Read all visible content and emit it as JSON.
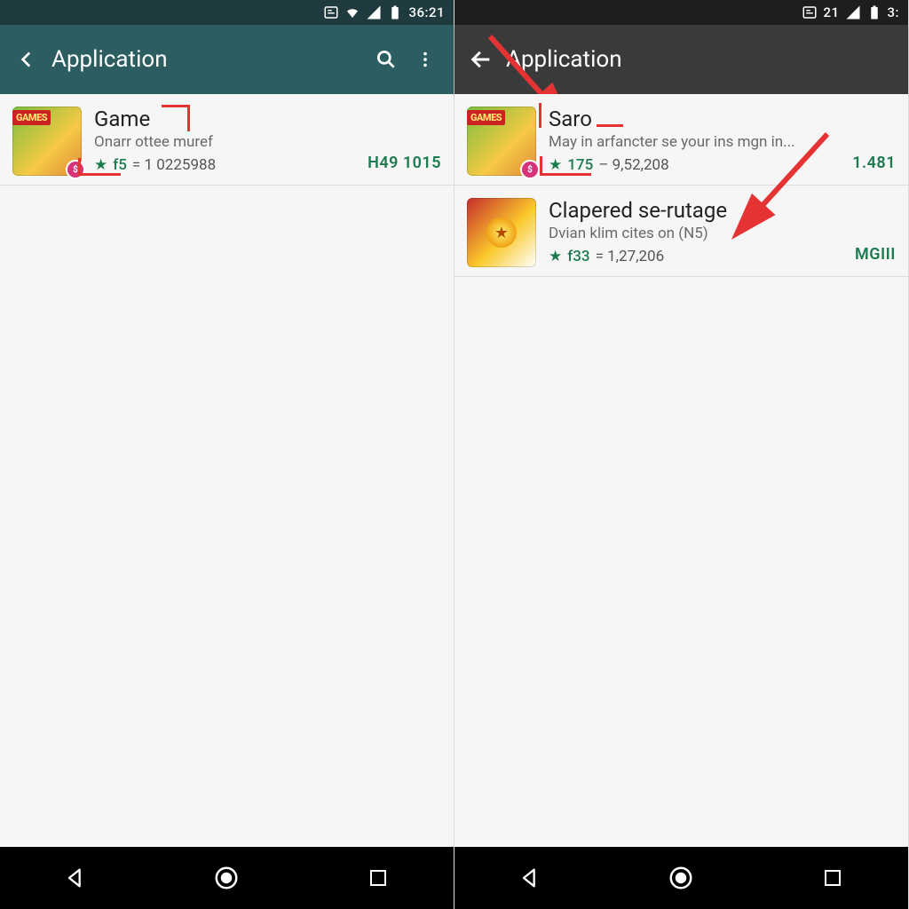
{
  "left": {
    "status": {
      "time": "36:21"
    },
    "appbar": {
      "title": "Application"
    },
    "items": [
      {
        "title": "Game",
        "subtitle": "Onarr ottee muref",
        "rating": "f5",
        "count": "= 1 0225988",
        "price": "H49 1015",
        "thumb_label": "GAMES",
        "thumb_badge": "$"
      }
    ]
  },
  "right": {
    "status": {
      "signal": "21",
      "time": "3:"
    },
    "appbar": {
      "title": "Application"
    },
    "items": [
      {
        "title": "Saro",
        "subtitle": "May in arfancter se your ins mgn in...",
        "rating": "175",
        "count": "– 9,52,208",
        "price": "1.481",
        "thumb_label": "GAMES",
        "thumb_badge": "$"
      },
      {
        "title": "Clapered se-rutage",
        "subtitle": "Dvian klim cites on (N5)",
        "rating": "f33",
        "count": "= 1,27,206",
        "price": "MGIII"
      }
    ]
  }
}
